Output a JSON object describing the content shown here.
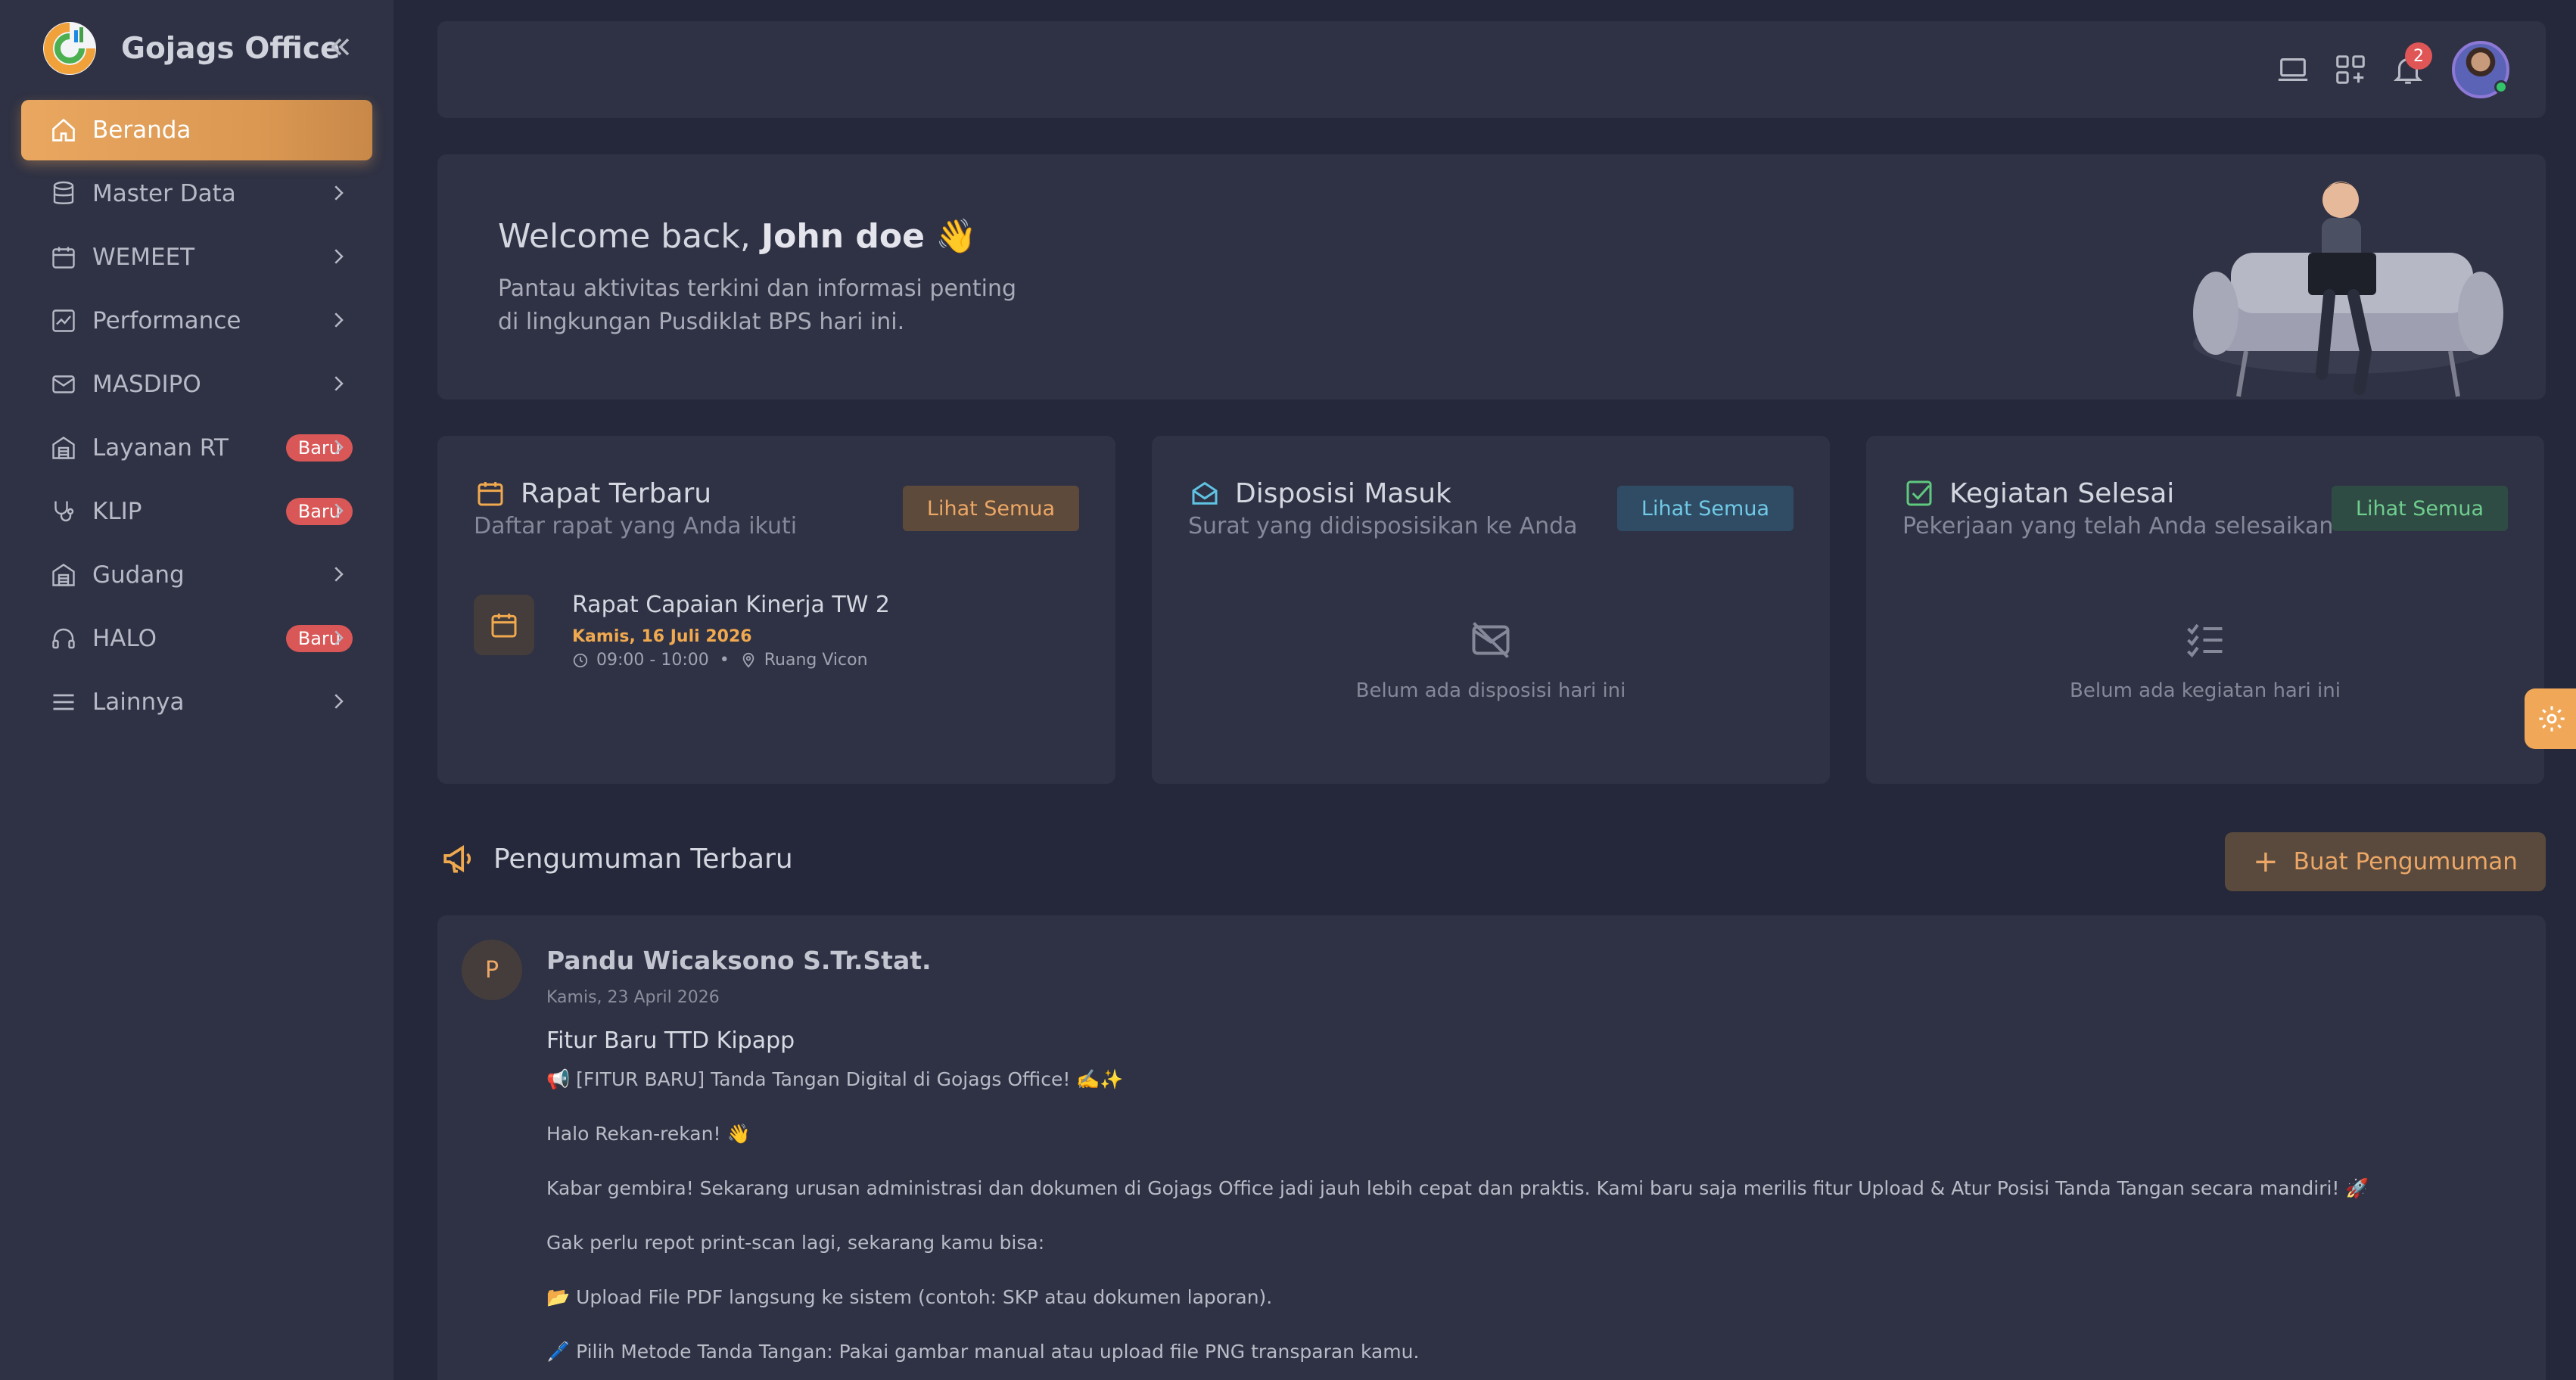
{
  "app": {
    "name": "Gojags Office"
  },
  "sidebar": {
    "items": [
      {
        "label": "Beranda",
        "icon": "home-icon",
        "active": true
      },
      {
        "label": "Master Data",
        "icon": "database-icon"
      },
      {
        "label": "WEMEET",
        "icon": "calendar-icon"
      },
      {
        "label": "Performance",
        "icon": "chart-icon"
      },
      {
        "label": "MASDIPO",
        "icon": "mail-icon"
      },
      {
        "label": "Layanan RT",
        "icon": "building-icon",
        "badge": "Baru"
      },
      {
        "label": "KLIP",
        "icon": "stethoscope-icon",
        "badge": "Baru"
      },
      {
        "label": "Gudang",
        "icon": "warehouse-icon"
      },
      {
        "label": "HALO",
        "icon": "headset-icon",
        "badge": "Baru"
      },
      {
        "label": "Lainnya",
        "icon": "menu-icon"
      }
    ]
  },
  "topbar": {
    "notification_count": "2"
  },
  "welcome": {
    "greeting": "Welcome back,",
    "name": "John doe",
    "emoji": "👋",
    "line1": "Pantau aktivitas terkini dan informasi penting",
    "line2": "di lingkungan Pusdiklat BPS hari ini."
  },
  "cards": {
    "rapat": {
      "title": "Rapat Terbaru",
      "subtitle": "Daftar rapat yang Anda ikuti",
      "button": "Lihat Semua",
      "meeting": {
        "title": "Rapat Capaian Kinerja TW 2",
        "date": "Kamis, 16 Juli 2026",
        "time": "09:00 - 10:00",
        "location": "Ruang Vicon"
      }
    },
    "disposisi": {
      "title": "Disposisi Masuk",
      "subtitle": "Surat yang didisposisikan ke Anda",
      "button": "Lihat Semua",
      "empty": "Belum ada disposisi hari ini"
    },
    "kegiatan": {
      "title": "Kegiatan Selesai",
      "subtitle": "Pekerjaan yang telah Anda selesaikan",
      "button": "Lihat Semua",
      "empty": "Belum ada kegiatan hari ini"
    }
  },
  "announcements": {
    "title": "Pengumuman Terbaru",
    "create_button": "Buat Pengumuman",
    "post": {
      "avatar_letter": "P",
      "author": "Pandu Wicaksono S.Tr.Stat.",
      "date": "Kamis, 23 April 2026",
      "title": "Fitur Baru TTD Kipapp",
      "lines": [
        "📢 [FITUR BARU] Tanda Tangan Digital di Gojags Office! ✍️✨",
        "Halo Rekan-rekan! 👋",
        "Kabar gembira! Sekarang urusan administrasi dan dokumen di Gojags Office jadi jauh lebih cepat dan praktis. Kami baru saja merilis fitur Upload & Atur Posisi Tanda Tangan secara mandiri! 🚀",
        "Gak perlu repot print-scan lagi, sekarang kamu bisa:",
        "📂 Upload File PDF langsung ke sistem (contoh: SKP atau dokumen laporan).",
        "🖊️ Pilih Metode Tanda Tangan: Pakai gambar manual atau upload file PNG transparan kamu."
      ]
    }
  },
  "colors": {
    "accent": "#e9a760",
    "background": "#25283a",
    "panel": "#2f3244",
    "badge": "#d95757"
  }
}
